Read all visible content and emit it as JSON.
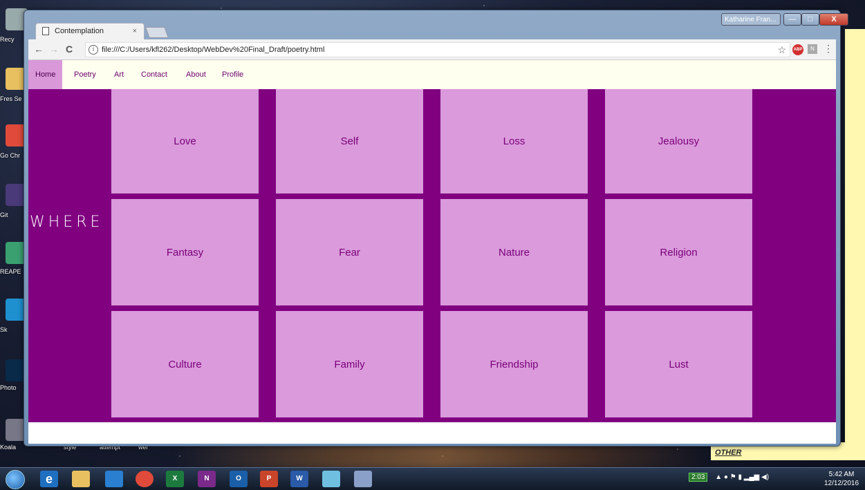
{
  "browser": {
    "tab_title": "Contemplation",
    "tab_close": "×",
    "url": "file:///C:/Users/kfl262/Desktop/WebDev%20Final_Draft/poetry.html",
    "user_badge": "Katharine Fran...",
    "back": "←",
    "forward": "→",
    "reload": "C",
    "info": "i",
    "star": "☆",
    "ext_abp": "ABP",
    "ext_other": "N",
    "menu": "⋮",
    "min": "—",
    "max": "□",
    "close": "X"
  },
  "site_nav": {
    "items": [
      {
        "label": "Home",
        "active": true
      },
      {
        "label": "Poetry",
        "active": false
      },
      {
        "label": "Art",
        "active": false
      },
      {
        "label": "Contact",
        "active": false
      },
      {
        "label": "About",
        "active": false
      },
      {
        "label": "Profile",
        "active": false
      }
    ]
  },
  "page": {
    "tagline": "WHERE P",
    "tiles": [
      "Love",
      "Self",
      "Loss",
      "Jealousy",
      "Fantasy",
      "Fear",
      "Nature",
      "Religion",
      "Culture",
      "Family",
      "Friendship",
      "Lust"
    ]
  },
  "desktop": {
    "icons": [
      "Recy",
      "Fres Se",
      "Go Chr",
      "Git",
      "REAPE",
      "Sk",
      "Photo",
      "Koala"
    ],
    "taskbar_labels": [
      "style",
      "attempt",
      "wel"
    ],
    "sticky_text": "OTHER"
  },
  "taskbar": {
    "apps": [
      "e",
      "",
      "",
      "",
      "X",
      "N",
      "O",
      "P",
      "W",
      "",
      ""
    ],
    "tray_timer": "2:03",
    "time": "5:42 AM",
    "date": "12/12/2016"
  },
  "colors": {
    "site_purple": "#800080",
    "tile_pink": "#da9adb",
    "tile_text": "#7a007a",
    "nav_bg": "#fffff0"
  }
}
